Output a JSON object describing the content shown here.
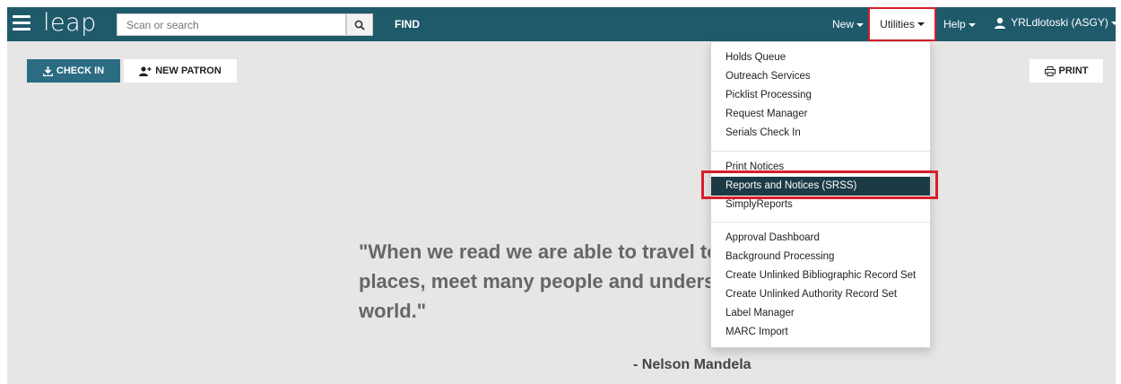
{
  "navbar": {
    "logo": "leap",
    "search_placeholder": "Scan or search",
    "find_label": "FIND",
    "new_label": "New",
    "utilities_label": "Utilities",
    "help_label": "Help",
    "user_label": "YRLdlotoski (ASGY)"
  },
  "actions": {
    "checkin_label": "CHECK IN",
    "new_patron_label": "NEW PATRON",
    "print_label": "PRINT"
  },
  "quote": {
    "text": "\"When we read we are able to travel to many places, meet many people and understand the world.\"",
    "author": "- Nelson Mandela"
  },
  "utilities_menu": {
    "group1": [
      "Holds Queue",
      "Outreach Services",
      "Picklist Processing",
      "Request Manager",
      "Serials Check In"
    ],
    "group2": [
      "Print Notices",
      "Reports and Notices (SRSS)",
      "SimplyReports"
    ],
    "group3": [
      "Approval Dashboard",
      "Background Processing",
      "Create Unlinked Bibliographic Record Set",
      "Create Unlinked Authority Record Set",
      "Label Manager",
      "MARC Import"
    ]
  },
  "colors": {
    "navbar": "#1f5a6b",
    "checkin_button": "#2b6c83",
    "highlight_border": "#d81e2a",
    "active_menu_item": "#1c3a46",
    "content_background": "#e7e6e5"
  }
}
